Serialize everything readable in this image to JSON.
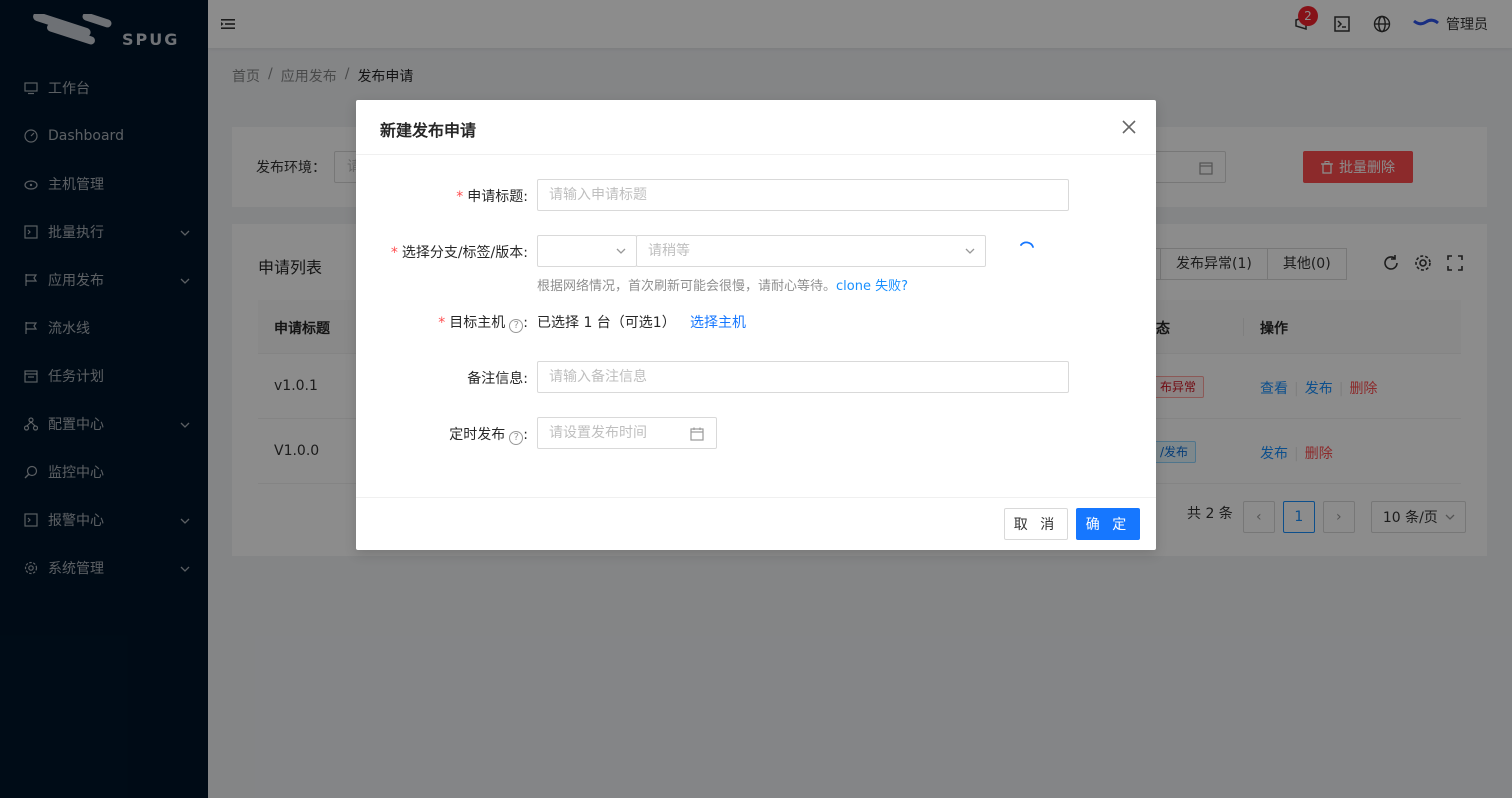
{
  "app": {
    "logo_text": "SPUG"
  },
  "sidebar": {
    "items": [
      {
        "label": "工作台",
        "icon": "desktop-icon",
        "has_arrow": false
      },
      {
        "label": "Dashboard",
        "icon": "dashboard-icon",
        "has_arrow": false
      },
      {
        "label": "主机管理",
        "icon": "cloud-server-icon",
        "has_arrow": false
      },
      {
        "label": "批量执行",
        "icon": "code-icon",
        "has_arrow": true
      },
      {
        "label": "应用发布",
        "icon": "flag-icon",
        "has_arrow": true
      },
      {
        "label": "流水线",
        "icon": "flag-icon",
        "has_arrow": false
      },
      {
        "label": "任务计划",
        "icon": "schedule-icon",
        "has_arrow": false
      },
      {
        "label": "配置中心",
        "icon": "deployment-icon",
        "has_arrow": true
      },
      {
        "label": "监控中心",
        "icon": "monitor-icon",
        "has_arrow": false
      },
      {
        "label": "报警中心",
        "icon": "alert-icon",
        "has_arrow": true
      },
      {
        "label": "系统管理",
        "icon": "setting-icon",
        "has_arrow": true
      }
    ]
  },
  "header": {
    "notification_count": "2",
    "user_name": "管理员"
  },
  "breadcrumb": [
    "首页",
    "应用发布",
    "发布申请"
  ],
  "filter": {
    "env_label": "发布环境：",
    "env_placeholder": "请",
    "batch_delete_label": "批量删除"
  },
  "list": {
    "title": "申请列表",
    "status_tabs": [
      "发布异常(1)",
      "其他(0)"
    ],
    "columns": {
      "title": "申请标题",
      "status": "态",
      "actions": "操作"
    },
    "rows": [
      {
        "title": "v1.0.1",
        "status": "布异常",
        "actions": [
          "查看",
          "发布",
          "删除"
        ]
      },
      {
        "title": "V1.0.0",
        "status": "/发布",
        "actions": [
          "发布",
          "删除"
        ]
      }
    ],
    "pagination": {
      "total": "共 2 条",
      "current": "1",
      "page_size": "10 条/页"
    }
  },
  "modal": {
    "title": "新建发布申请",
    "fields": {
      "title_label": "申请标题",
      "title_placeholder": "请输入申请标题",
      "branch_label": "选择分支/标签/版本",
      "version_placeholder": "请稍等",
      "branch_help": "根据网络情况，首次刷新可能会很慢，请耐心等待。",
      "clone_fail_link": "clone 失败?",
      "host_label": "目标主机",
      "host_selected": "已选择 1 台（可选1）",
      "host_select_link": "选择主机",
      "remark_label": "备注信息",
      "remark_placeholder": "请输入备注信息",
      "schedule_label": "定时发布",
      "schedule_placeholder": "请设置发布时间"
    },
    "buttons": {
      "cancel": "取 消",
      "ok": "确 定"
    }
  },
  "colors": {
    "sidebar_bg": "#001529",
    "primary": "#1677ff",
    "danger": "#ff4d4f"
  }
}
